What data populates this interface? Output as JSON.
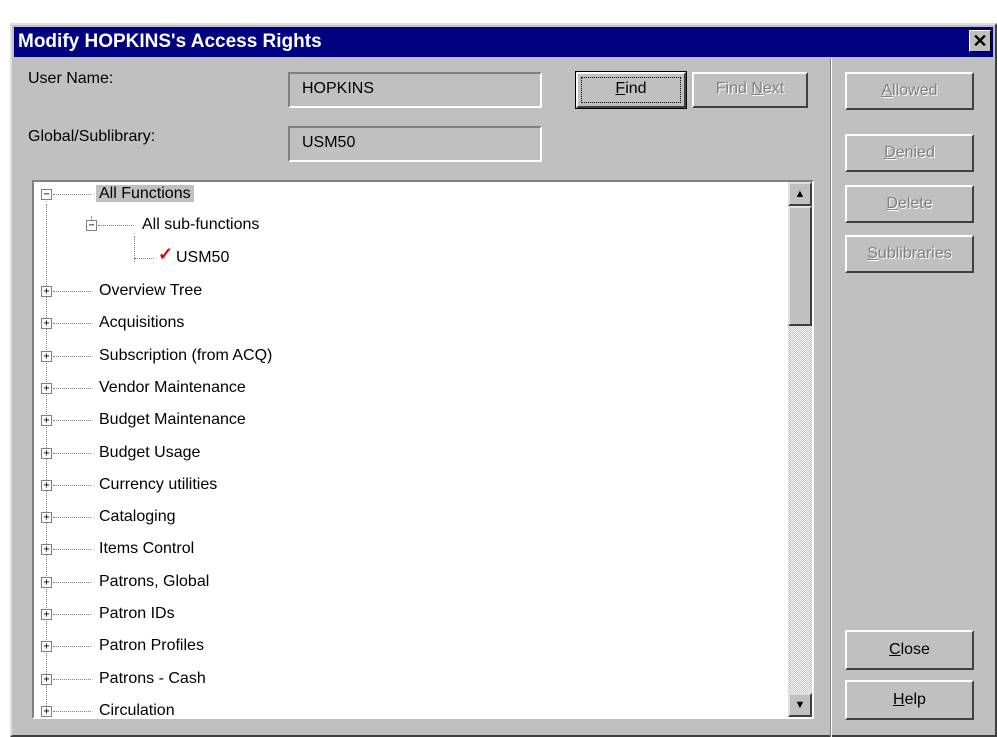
{
  "window": {
    "title": "Modify HOPKINS's Access Rights",
    "close_symbol": "✕"
  },
  "form": {
    "user_name_label": "User Name:",
    "user_name_value": "HOPKINS",
    "global_label": "Global/Sublibrary:",
    "global_value": "USM50"
  },
  "buttons": {
    "find": {
      "pre": "",
      "key": "F",
      "post": "ind"
    },
    "find_next": {
      "pre": "Find ",
      "key": "N",
      "post": "ext"
    },
    "allowed": {
      "pre": "",
      "key": "A",
      "post": "llowed"
    },
    "denied": {
      "pre": "",
      "key": "D",
      "post": "enied"
    },
    "delete": {
      "pre": "",
      "key": "D",
      "post": "elete"
    },
    "sublibraries": {
      "pre": "",
      "key": "S",
      "post": "ublibraries"
    },
    "close": {
      "pre": "",
      "key": "C",
      "post": "lose"
    },
    "help": {
      "pre": "",
      "key": "H",
      "post": "elp"
    }
  },
  "tree": {
    "root": {
      "label": "All Functions",
      "expander": "−"
    },
    "sub": {
      "label": "All sub-functions",
      "expander": "−"
    },
    "leaf": {
      "label": "USM50",
      "check": "✓"
    },
    "items": [
      {
        "label": "Overview Tree",
        "expander": "+"
      },
      {
        "label": "Acquisitions",
        "expander": "+"
      },
      {
        "label": "Subscription (from ACQ)",
        "expander": "+"
      },
      {
        "label": "Vendor Maintenance",
        "expander": "+"
      },
      {
        "label": "Budget Maintenance",
        "expander": "+"
      },
      {
        "label": "Budget Usage",
        "expander": "+"
      },
      {
        "label": "Currency utilities",
        "expander": "+"
      },
      {
        "label": "Cataloging",
        "expander": "+"
      },
      {
        "label": "Items Control",
        "expander": "+"
      },
      {
        "label": "Patrons, Global",
        "expander": "+"
      },
      {
        "label": "Patron IDs",
        "expander": "+"
      },
      {
        "label": "Patron Profiles",
        "expander": "+"
      },
      {
        "label": "Patrons - Cash",
        "expander": "+"
      },
      {
        "label": "Circulation",
        "expander": "+"
      }
    ]
  },
  "scrollbar": {
    "up_arrow": "▲",
    "down_arrow": "▼"
  }
}
